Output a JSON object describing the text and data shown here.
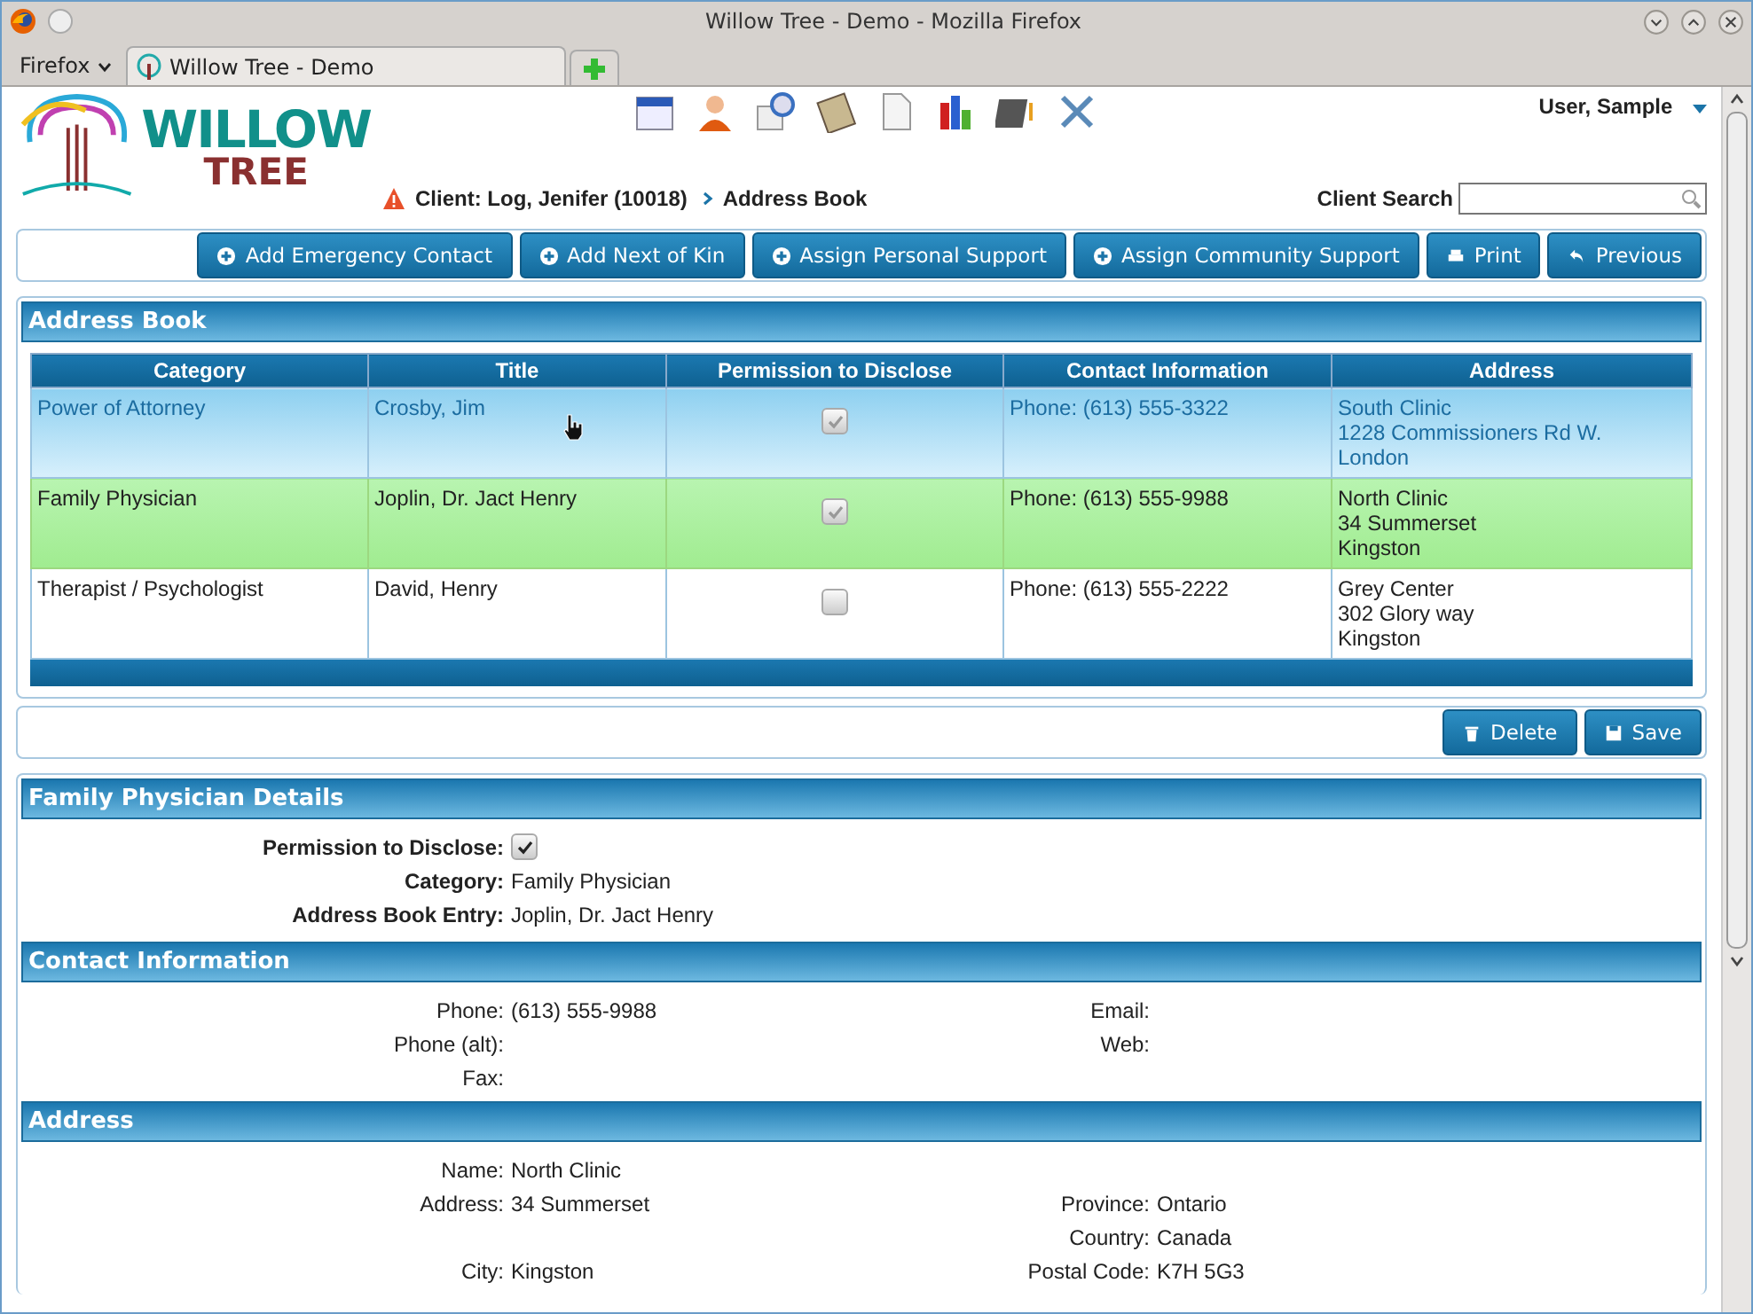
{
  "window": {
    "title": "Willow Tree - Demo - Mozilla Firefox"
  },
  "browser": {
    "menu": "Firefox",
    "tabs": [
      {
        "label": "Willow Tree - Demo",
        "selected": true
      }
    ]
  },
  "app": {
    "logo_top": "WILLOW",
    "logo_bottom": "TREE",
    "user": "User, Sample",
    "breadcrumb": {
      "client": "Client: Log, Jenifer (10018)",
      "page": "Address Book"
    },
    "search_label": "Client Search"
  },
  "actions": [
    {
      "label": "Add Emergency Contact",
      "kind": "add"
    },
    {
      "label": "Add Next of Kin",
      "kind": "add"
    },
    {
      "label": "Assign Personal Support",
      "kind": "add"
    },
    {
      "label": "Assign Community Support",
      "kind": "add"
    },
    {
      "label": "Print",
      "kind": "print"
    },
    {
      "label": "Previous",
      "kind": "back"
    }
  ],
  "address_book": {
    "title": "Address Book",
    "columns": [
      "Category",
      "Title",
      "Permission to Disclose",
      "Contact Information",
      "Address"
    ],
    "rows": [
      {
        "category": "Power of Attorney",
        "title": "Crosby, Jim",
        "permission": true,
        "contact": "Phone: (613) 555-3322",
        "address": [
          "South Clinic",
          "1228 Commissioners Rd W.",
          "London"
        ],
        "selected": false,
        "hovered": true
      },
      {
        "category": "Family Physician",
        "title": "Joplin, Dr. Jact Henry",
        "permission": true,
        "contact": "Phone: (613) 555-9988",
        "address": [
          "North Clinic",
          "34 Summerset",
          "Kingston"
        ],
        "selected": true,
        "hovered": false
      },
      {
        "category": "Therapist / Psychologist",
        "title": "David, Henry",
        "permission": false,
        "contact": "Phone: (613) 555-2222",
        "address": [
          "Grey Center",
          "302 Glory way",
          "Kingston"
        ],
        "selected": false,
        "hovered": false
      }
    ]
  },
  "record_actions": [
    {
      "label": "Delete",
      "kind": "delete"
    },
    {
      "label": "Save",
      "kind": "save"
    }
  ],
  "details": {
    "title": "Family Physician Details",
    "permission_label": "Permission to Disclose:",
    "permission": true,
    "fields": [
      {
        "label": "Category:",
        "value": "Family Physician"
      },
      {
        "label": "Address Book Entry:",
        "value": "Joplin, Dr. Jact Henry"
      }
    ]
  },
  "contact_information": {
    "title": "Contact Information",
    "rows": [
      {
        "left": {
          "label": "Phone:",
          "value": "(613) 555-9988"
        },
        "right": {
          "label": "Email:"
        }
      },
      {
        "left": {
          "label": "Phone (alt):"
        },
        "right": {
          "label": "Web:"
        }
      },
      {
        "left": {
          "label": "Fax:"
        }
      }
    ]
  },
  "address": {
    "title": "Address",
    "rows": [
      {
        "left": {
          "label": "Name:",
          "value": "North Clinic"
        }
      },
      {
        "left": {
          "label": "Address:",
          "value": "34 Summerset"
        },
        "right": {
          "label": "Province:",
          "value": "Ontario"
        }
      },
      {
        "right": {
          "label": "Country:",
          "value": "Canada"
        }
      },
      {
        "left": {
          "label": "City:",
          "value": "Kingston"
        },
        "right": {
          "label": "Postal Code:",
          "value": "K7H 5G3"
        }
      }
    ]
  }
}
